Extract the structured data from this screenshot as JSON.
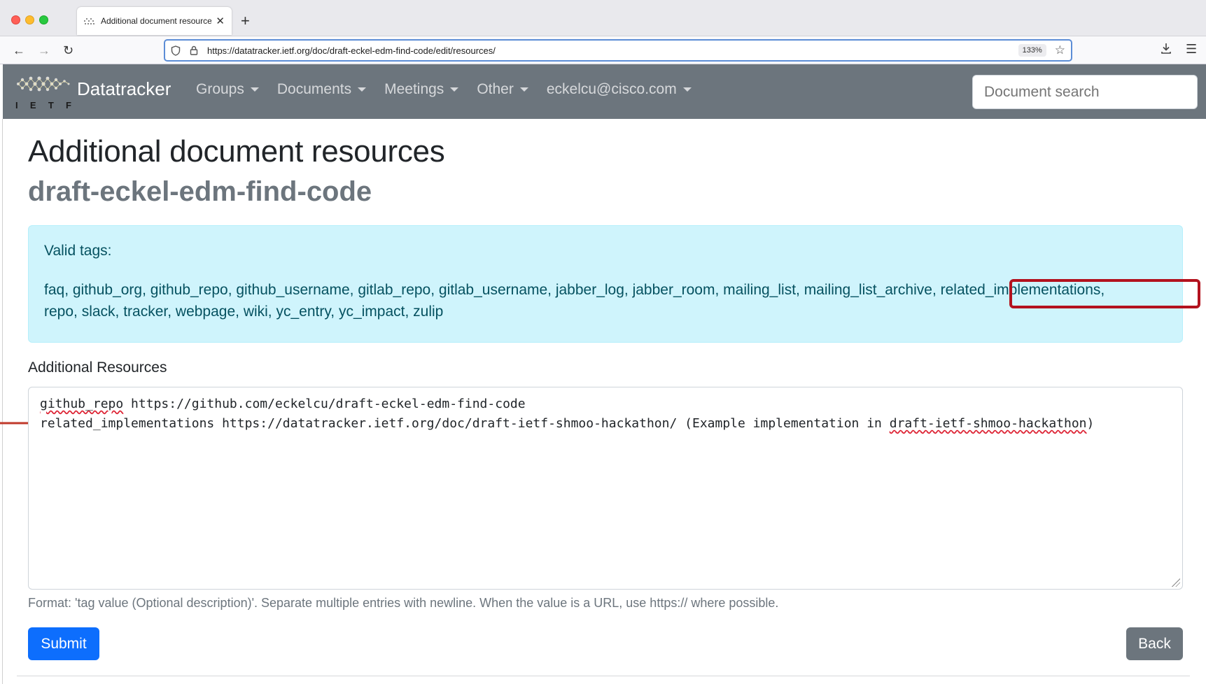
{
  "browser": {
    "tab_title": "Additional document resources",
    "url": "https://datatracker.ietf.org/doc/draft-eckel-edm-find-code/edit/resources/",
    "zoom": "133%",
    "icons": [
      "back-icon",
      "forward-icon",
      "reload-icon",
      "shield-icon",
      "lock-icon",
      "star-icon",
      "download-icon",
      "menu-icon"
    ]
  },
  "nav": {
    "logo_letters": [
      "I",
      "E",
      "T",
      "F"
    ],
    "brand": "Datatracker",
    "items": [
      {
        "label": "Groups"
      },
      {
        "label": "Documents"
      },
      {
        "label": "Meetings"
      },
      {
        "label": "Other"
      },
      {
        "label": "eckelcu@cisco.com"
      }
    ],
    "search_placeholder": "Document search",
    "background": "#6c757d"
  },
  "page": {
    "title": "Additional document resources",
    "subtitle": "draft-eckel-edm-find-code"
  },
  "alert": {
    "heading": "Valid tags:",
    "tags_line_1": "faq, github_org, github_repo, github_username, gitlab_repo, gitlab_username, jabber_log, jabber_room, mailing_list, mailing_list_archive, related_implementations,",
    "tags_line_2": "repo, slack, tracker, webpage, wiki, yc_entry, yc_impact, zulip",
    "highlight_color": "#b3121e"
  },
  "form": {
    "label": "Additional Resources",
    "resources_lines": [
      {
        "tag": "github_repo",
        "rest": " https://github.com/eckelcu/draft-eckel-edm-find-code"
      },
      {
        "tag": "related_implementations",
        "rest": " https://datatracker.ietf.org/doc/draft-ietf-shmoo-hackathon/ (Example implementation in ",
        "spell": "draft-ietf-shmoo-hackathon",
        "tail": ")"
      }
    ],
    "help": "Format: 'tag value (Optional description)'. Separate multiple entries with newline. When the value is a URL, use https:// where possible.",
    "submit_label": "Submit",
    "back_label": "Back"
  },
  "colors": {
    "primary": "#0d6efd",
    "secondary": "#6c757d",
    "alert_bg": "#cff4fc",
    "alert_text": "#055160"
  }
}
